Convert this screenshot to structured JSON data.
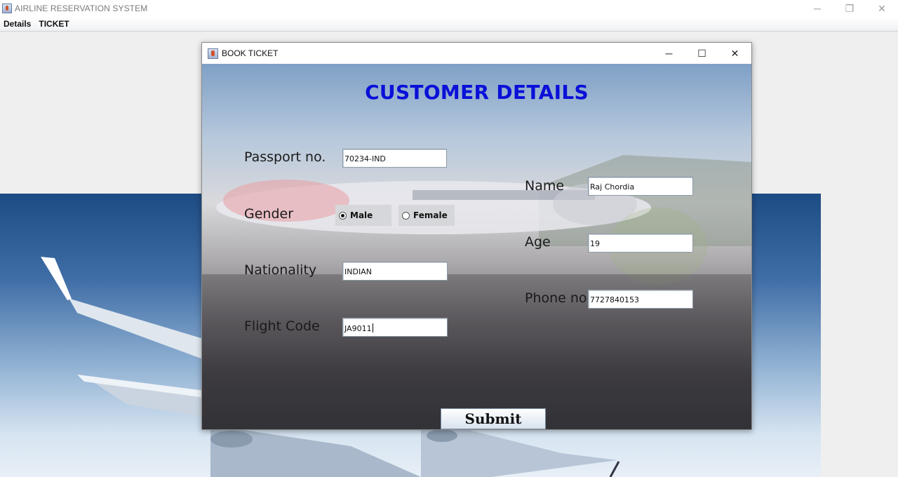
{
  "window": {
    "title": "AIRLINE RESERVATION SYSTEM",
    "minimize_glyph": "─",
    "restore_glyph": "❐",
    "close_glyph": "✕"
  },
  "menu": {
    "items": [
      {
        "label": "Details"
      },
      {
        "label": "TICKET"
      }
    ]
  },
  "dialog": {
    "title": "BOOK TICKET",
    "minimize_glyph": "─",
    "maximize_glyph": "☐",
    "close_glyph": "✕"
  },
  "form": {
    "heading": "CUSTOMER DETAILS",
    "passport": {
      "label": "Passport no.",
      "value": "70234-IND"
    },
    "gender": {
      "label": "Gender",
      "options": [
        {
          "label": "Male",
          "selected": true
        },
        {
          "label": "Female",
          "selected": false
        }
      ]
    },
    "nationality": {
      "label": "Nationality",
      "value": "INDIAN"
    },
    "flight_code": {
      "label": "Flight Code",
      "value": "JA9011"
    },
    "name": {
      "label": "Name",
      "value": "Raj Chordia"
    },
    "age": {
      "label": "Age",
      "value": "19"
    },
    "phone": {
      "label": "Phone no",
      "value": "7727840153"
    },
    "submit_label": "Submit"
  },
  "colors": {
    "heading": "#0a10d8",
    "desktop_sky": "#1d4b84"
  }
}
